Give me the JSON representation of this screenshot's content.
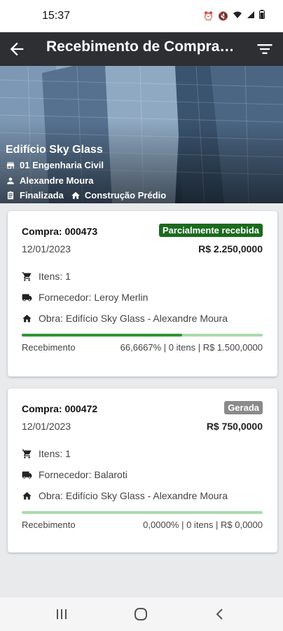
{
  "status_bar": {
    "time": "15:37"
  },
  "app_bar": {
    "title": "Recebimento de Compras…",
    "back_icon": "arrow-back-icon",
    "filter_icon": "filter-list-icon"
  },
  "project": {
    "name": "Edifício Sky Glass",
    "company": "01 Engenharia Civil",
    "manager": "Alexandre Moura",
    "status": "Finalizada",
    "type": "Construção Prédio"
  },
  "colors": {
    "accent_green": "#2e9632",
    "badge_partial": "#1a6b1e",
    "badge_generated": "#8a8a8a",
    "progress_track": "#a9dbab",
    "app_bar": "#2d2f32"
  },
  "purchases": [
    {
      "title": "Compra: 000473",
      "status": "Parcialmente recebida",
      "date": "12/01/2023",
      "value": "R$ 2.250,0000",
      "items": "Itens: 1",
      "supplier": "Fornecedor: Leroy Merlin",
      "work": "Obra: Edifício Sky Glass - Alexandre Moura",
      "received_label": "Recebimento",
      "received_summary": "66,6667% | 0 itens | R$ 1.500,0000",
      "received_fraction": 0.666667
    },
    {
      "title": "Compra: 000472",
      "status": "Gerada",
      "date": "12/01/2023",
      "value": "R$ 750,0000",
      "items": "Itens: 1",
      "supplier": "Fornecedor: Balaroti",
      "work": "Obra: Edifício Sky Glass - Alexandre Moura",
      "received_label": "Recebimento",
      "received_summary": "0,0000% | 0 itens | R$ 0,0000",
      "received_fraction": 0
    }
  ]
}
